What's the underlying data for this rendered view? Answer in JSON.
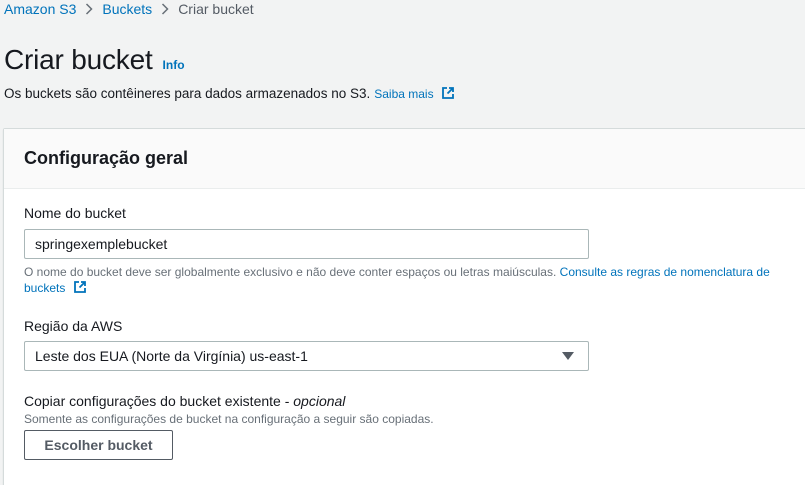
{
  "breadcrumb": {
    "items": [
      "Amazon S3",
      "Buckets"
    ],
    "current": "Criar bucket"
  },
  "page": {
    "title": "Criar bucket",
    "info_link": "Info",
    "description": "Os buckets são contêineres para dados armazenados no S3.",
    "learn_more": "Saiba mais"
  },
  "panel": {
    "title": "Configuração geral",
    "bucket_name": {
      "label": "Nome do bucket",
      "value": "springexemplebucket",
      "hint_text": "O nome do bucket deve ser globalmente exclusivo e não deve conter espaços ou letras maiúsculas.",
      "hint_link": "Consulte as regras de nomenclatura de buckets"
    },
    "region": {
      "label": "Região da AWS",
      "selected": "Leste dos EUA (Norte da Virgínia) us-east-1"
    },
    "copy_settings": {
      "label": "Copiar configurações do bucket existente -",
      "optional": "opcional",
      "hint": "Somente as configurações de bucket na configuração a seguir são copiadas.",
      "button": "Escolher bucket"
    }
  },
  "colors": {
    "link": "#0073bb",
    "background": "#f2f3f3",
    "panel_header": "#fafafa"
  },
  "icons": [
    "chevron-right-icon",
    "external-link-icon",
    "caret-down-icon"
  ]
}
